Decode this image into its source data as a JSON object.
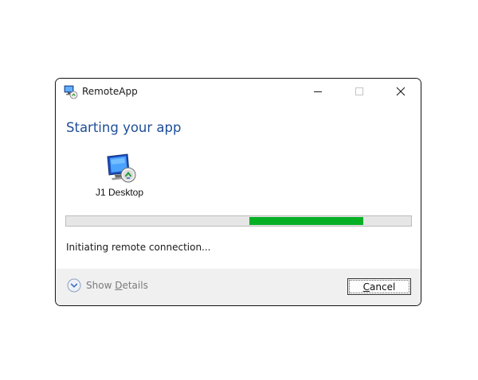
{
  "window": {
    "title": "RemoteApp",
    "icon": "remoteapp-icon"
  },
  "caption_buttons": {
    "minimize_icon": "minimize-icon",
    "maximize_icon": "maximize-icon",
    "close_icon": "close-icon"
  },
  "main": {
    "heading": "Starting your app",
    "resource": {
      "name": "J1 Desktop",
      "icon": "remote-desktop-icon"
    },
    "progress": {
      "state": "indeterminate",
      "fill_color": "#06b025"
    },
    "status": "Initiating remote connection..."
  },
  "footer": {
    "details": {
      "label_pre": "Show ",
      "label_accel": "D",
      "label_post": "etails",
      "icon": "chevron-down-circle-icon"
    },
    "cancel": {
      "label_accel": "C",
      "label_post": "ancel"
    }
  },
  "colors": {
    "heading": "#1f4e99",
    "progress_fill": "#06b025",
    "footer_bg": "#f0f0f0"
  }
}
